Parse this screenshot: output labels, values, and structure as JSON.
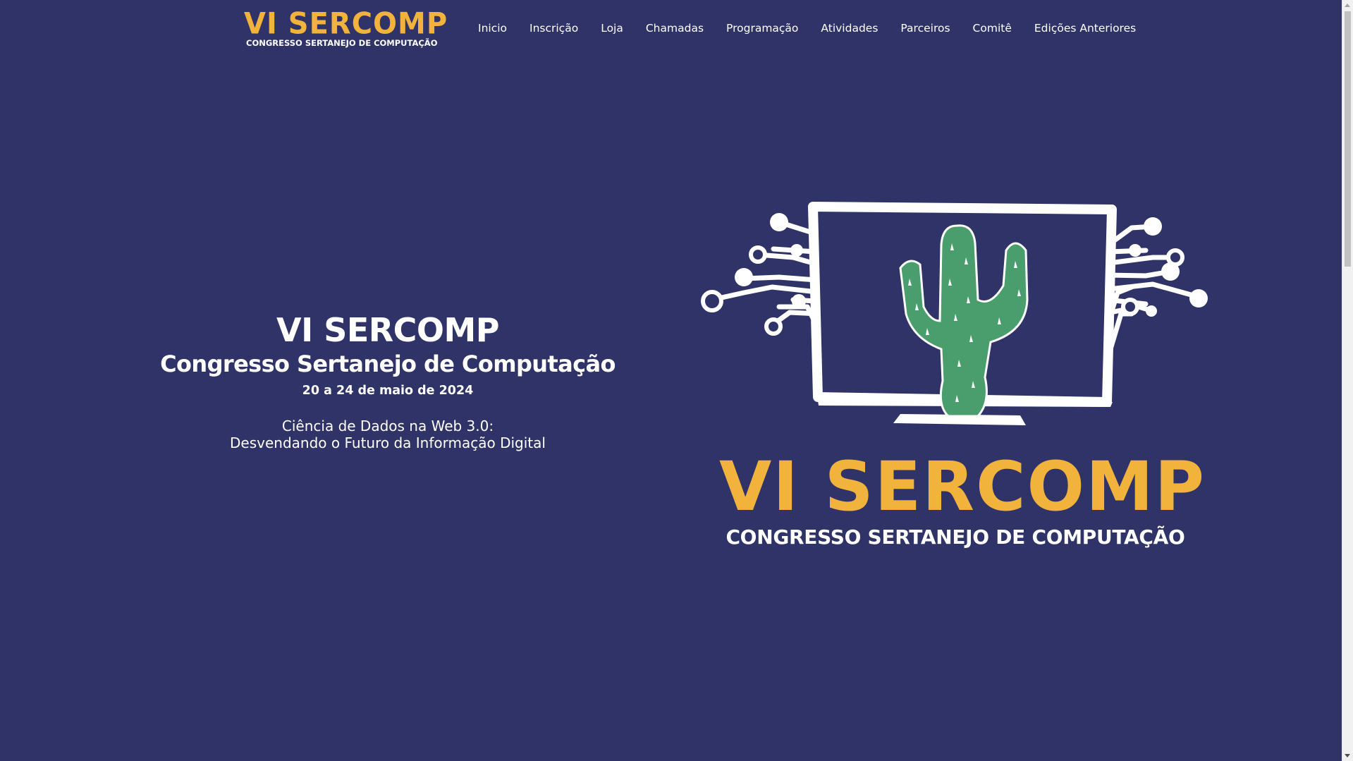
{
  "header": {
    "logo_title": "VI SERCOMP",
    "logo_subtitle": "CONGRESSO SERTANEJO DE COMPUTAÇÃO",
    "nav": [
      {
        "label": "Inicio"
      },
      {
        "label": "Inscrição"
      },
      {
        "label": "Loja"
      },
      {
        "label": "Chamadas"
      },
      {
        "label": "Programação"
      },
      {
        "label": "Atividades"
      },
      {
        "label": "Parceiros"
      },
      {
        "label": "Comitê"
      },
      {
        "label": "Edições Anteriores"
      }
    ]
  },
  "hero": {
    "title": "VI SERCOMP",
    "subtitle": "Congresso Sertanejo de Computação",
    "date": "20 a 24 de maio de 2024",
    "theme_line1": "Ciência de Dados na Web 3.0:",
    "theme_line2": "Desvendando o Futuro da Informação Digital",
    "logo_title": "VI SERCOMP",
    "logo_subtitle": "CONGRESSO SERTANEJO DE COMPUTAÇÃO"
  },
  "colors": {
    "background": "#2f3367",
    "accent_yellow": "#f2b33d",
    "cactus_green": "#4a9e6e",
    "text": "#ffffff"
  },
  "icons": {
    "hero_illustration": "monitor-with-cactus-circuit-icon"
  }
}
